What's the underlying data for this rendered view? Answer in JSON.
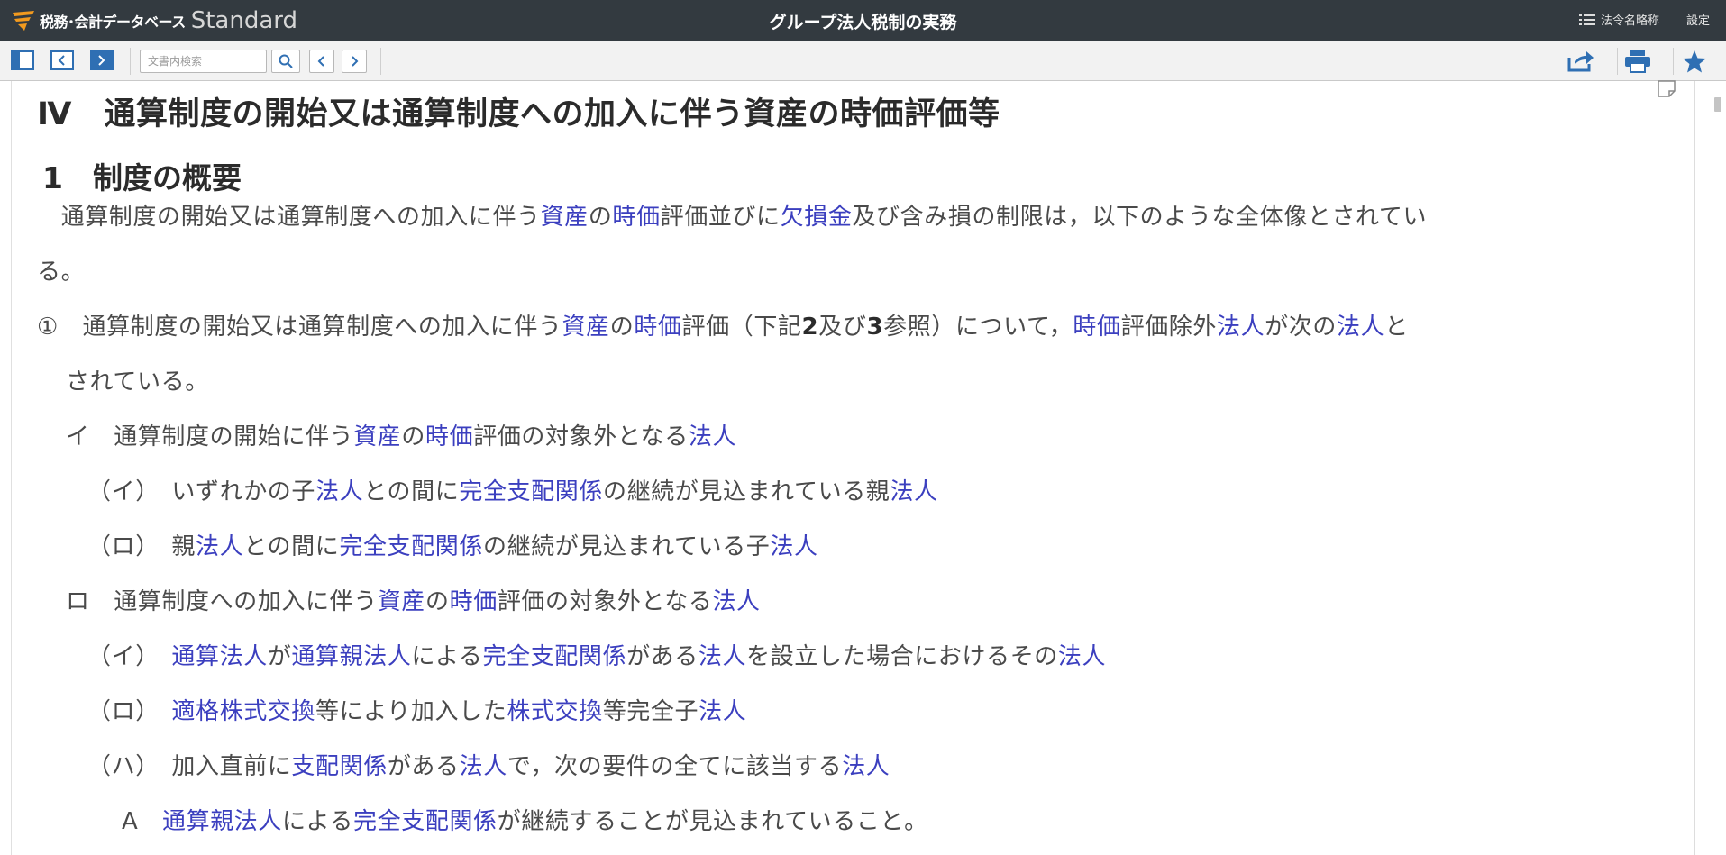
{
  "app": {
    "logo_text": "税務･会計データベース",
    "logo_sub": "Standard",
    "document_title": "グループ法人税制の実務",
    "law_abbrev_label": "法令名略称",
    "settings_label": "設定"
  },
  "toolbar": {
    "search_placeholder": "文書内検索"
  },
  "colors": {
    "titlebar_bg": "#333a40",
    "toolbar_bg": "#f2f2f2",
    "link": "#3b3fbf",
    "text": "#4a4a4a",
    "icon_blue": "#2f6fb3"
  },
  "content": {
    "heading1": "Ⅳ　通算制度の開始又は通算制度への加入に伴う資産の時価評価等",
    "heading2": "1　制度の概要",
    "lines": [
      {
        "segments": [
          {
            "t": "　通算制度の開始又は通算制度への加入に伴う"
          },
          {
            "t": "資産",
            "link": true
          },
          {
            "t": "の"
          },
          {
            "t": "時価",
            "link": true
          },
          {
            "t": "評価並びに"
          },
          {
            "t": "欠損金",
            "link": true
          },
          {
            "t": "及び含み損の制限は，以下のような全体像とされてい"
          }
        ]
      },
      {
        "segments": [
          {
            "t": "る。"
          }
        ]
      },
      {
        "segments": [
          {
            "t": "①　通算制度の開始又は通算制度への加入に伴う"
          },
          {
            "t": "資産",
            "link": true
          },
          {
            "t": "の"
          },
          {
            "t": "時価",
            "link": true
          },
          {
            "t": "評価（下記"
          },
          {
            "t": "2",
            "bold": true
          },
          {
            "t": "及び"
          },
          {
            "t": "3",
            "bold": true
          },
          {
            "t": "参照）について，"
          },
          {
            "t": "時価",
            "link": true
          },
          {
            "t": "評価除外"
          },
          {
            "t": "法人",
            "link": true
          },
          {
            "t": "が次の"
          },
          {
            "t": "法人",
            "link": true
          },
          {
            "t": "と"
          }
        ]
      },
      {
        "segments": [
          {
            "t": "されている。"
          }
        ]
      },
      {
        "segments": [
          {
            "t": "イ　通算制度の開始に伴う"
          },
          {
            "t": "資産",
            "link": true
          },
          {
            "t": "の"
          },
          {
            "t": "時価",
            "link": true
          },
          {
            "t": "評価の対象外となる"
          },
          {
            "t": "法人",
            "link": true
          }
        ]
      },
      {
        "segments": [
          {
            "t": "（イ）　いずれかの子"
          },
          {
            "t": "法人",
            "link": true
          },
          {
            "t": "との間に"
          },
          {
            "t": "完全支配関係",
            "link": true
          },
          {
            "t": "の継続が見込まれている親"
          },
          {
            "t": "法人",
            "link": true
          }
        ]
      },
      {
        "segments": [
          {
            "t": "（ロ）　親"
          },
          {
            "t": "法人",
            "link": true
          },
          {
            "t": "との間に"
          },
          {
            "t": "完全支配関係",
            "link": true
          },
          {
            "t": "の継続が見込まれている子"
          },
          {
            "t": "法人",
            "link": true
          }
        ]
      },
      {
        "segments": [
          {
            "t": "ロ　通算制度への加入に伴う"
          },
          {
            "t": "資産",
            "link": true
          },
          {
            "t": "の"
          },
          {
            "t": "時価",
            "link": true
          },
          {
            "t": "評価の対象外となる"
          },
          {
            "t": "法人",
            "link": true
          }
        ]
      },
      {
        "segments": [
          {
            "t": "（イ）　"
          },
          {
            "t": "通算法人",
            "link": true
          },
          {
            "t": "が"
          },
          {
            "t": "通算親法人",
            "link": true
          },
          {
            "t": "による"
          },
          {
            "t": "完全支配関係",
            "link": true
          },
          {
            "t": "がある"
          },
          {
            "t": "法人",
            "link": true
          },
          {
            "t": "を設立した場合におけるその"
          },
          {
            "t": "法人",
            "link": true
          }
        ]
      },
      {
        "segments": [
          {
            "t": "（ロ）　"
          },
          {
            "t": "適格株式交換",
            "link": true
          },
          {
            "t": "等により加入した"
          },
          {
            "t": "株式交換",
            "link": true
          },
          {
            "t": "等完全子"
          },
          {
            "t": "法人",
            "link": true
          }
        ]
      },
      {
        "segments": [
          {
            "t": "（ハ）　加入直前に"
          },
          {
            "t": "支配関係",
            "link": true
          },
          {
            "t": "がある"
          },
          {
            "t": "法人",
            "link": true
          },
          {
            "t": "で，次の要件の全てに該当する"
          },
          {
            "t": "法人",
            "link": true
          }
        ]
      },
      {
        "segments": [
          {
            "t": "A　"
          },
          {
            "t": "通算親法人",
            "link": true
          },
          {
            "t": "による"
          },
          {
            "t": "完全支配関係",
            "link": true
          },
          {
            "t": "が継続することが見込まれていること。"
          }
        ]
      }
    ]
  }
}
